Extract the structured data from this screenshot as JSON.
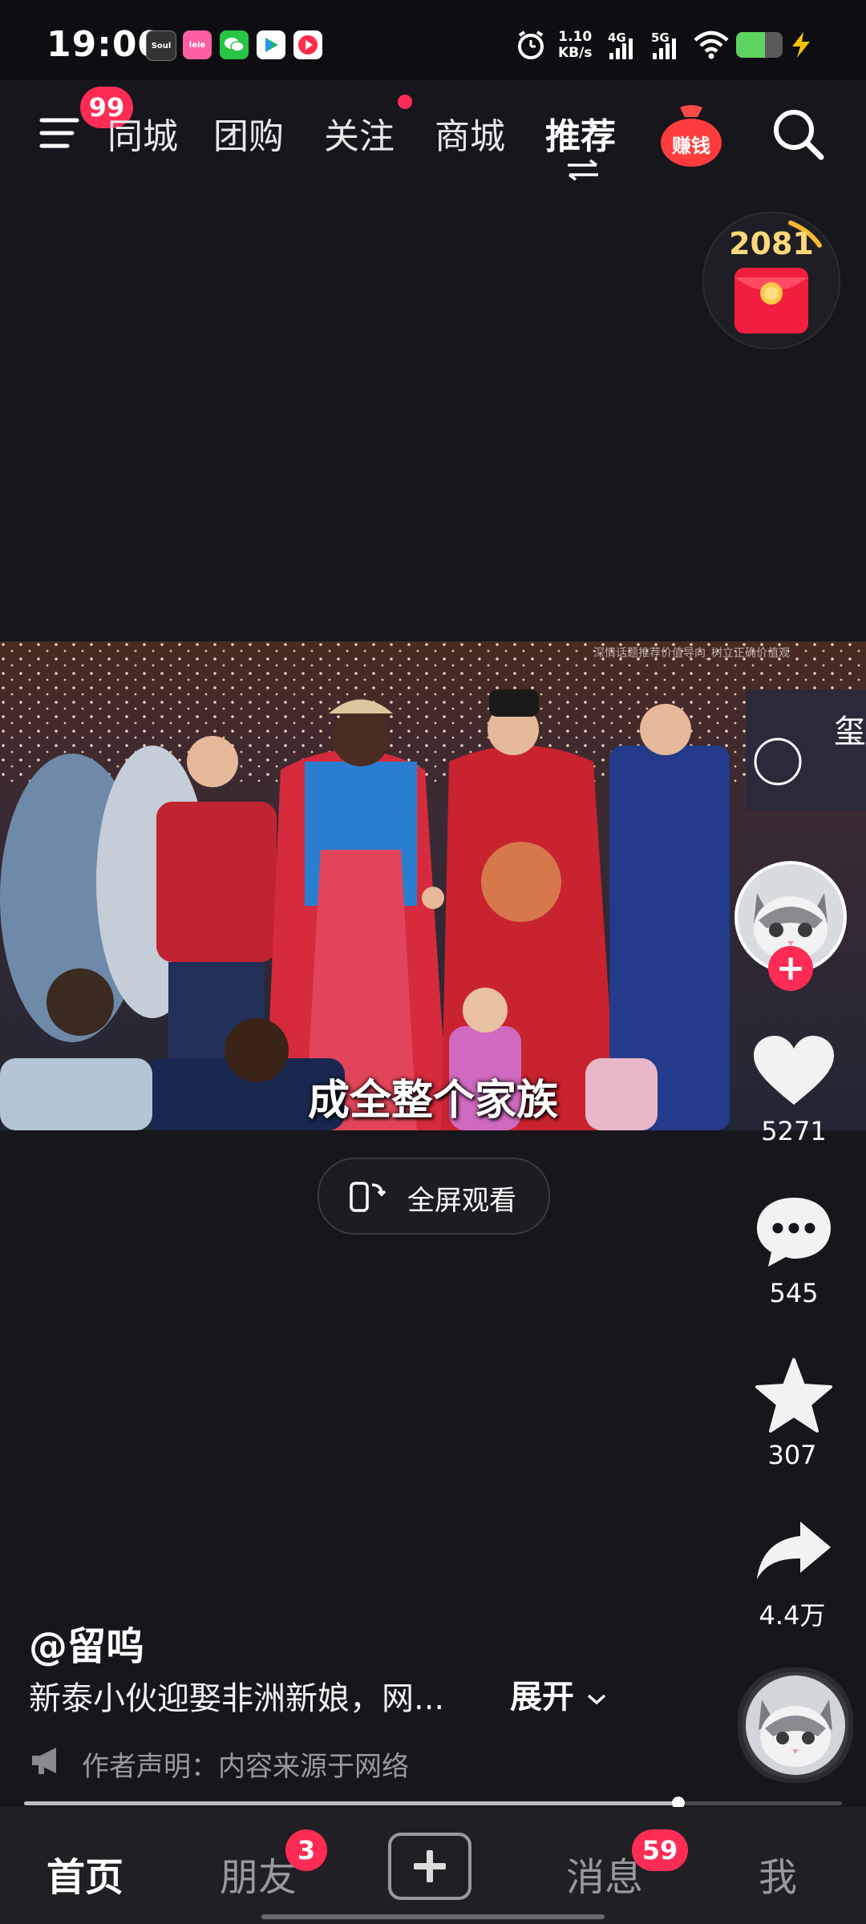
{
  "status_bar": {
    "time": "19:00",
    "apps": [
      {
        "name": "soul-icon",
        "label": "Soul",
        "color": "#333333"
      },
      {
        "name": "lailai-icon",
        "label": "lele",
        "color": "#ff5fa2"
      },
      {
        "name": "wechat-icon",
        "label": "",
        "color": "#28c445"
      },
      {
        "name": "play-store-icon",
        "label": "",
        "color": "#ffffff"
      },
      {
        "name": "video-app-icon",
        "label": "",
        "color": "#ff2c4a"
      }
    ],
    "net_speed_value": "1.10",
    "net_speed_unit": "KB/s",
    "signal_4g": "4G",
    "signal_5g": "5G",
    "battery_color": "#5fd35f"
  },
  "top_nav": {
    "menu_badge": "99",
    "tabs": [
      "同城",
      "团购",
      "关注",
      "商城",
      "推荐"
    ],
    "active_tab": "推荐",
    "earn_label": "赚钱"
  },
  "coin_counter": "2081",
  "video": {
    "caption": "成全整个家族",
    "watermark": "深情话题推荐价值导向_树立正确价值观",
    "stage_sign": "玺"
  },
  "fullscreen_label": "全屏观看",
  "right_rail": {
    "likes": "5271",
    "comments": "545",
    "favorites": "307",
    "shares": "4.4万"
  },
  "post": {
    "author": "@留呜",
    "description": "新泰小伙迎娶非洲新娘，网...",
    "expand_label": "展开",
    "disclaimer": "作者声明：内容来源于网络"
  },
  "progress": 0.8,
  "bottom_nav": {
    "items": [
      "首页",
      "朋友",
      "消息",
      "我"
    ],
    "friends_badge": "3",
    "messages_badge": "59"
  },
  "colors": {
    "accent": "#fe2c55",
    "background": "#16161c"
  }
}
